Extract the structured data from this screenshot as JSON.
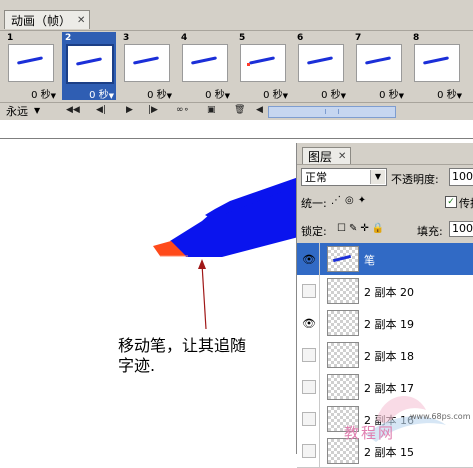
{
  "animation": {
    "tab_title": "动画（帧）",
    "frames": [
      {
        "num": "1",
        "delay": "0 秒"
      },
      {
        "num": "2",
        "delay": "0 秒"
      },
      {
        "num": "3",
        "delay": "0 秒"
      },
      {
        "num": "4",
        "delay": "0 秒"
      },
      {
        "num": "5",
        "delay": "0 秒"
      },
      {
        "num": "6",
        "delay": "0 秒"
      },
      {
        "num": "7",
        "delay": "0 秒"
      },
      {
        "num": "8",
        "delay": "0 秒"
      }
    ],
    "selected_frame_index": 1,
    "loop_option": "永远"
  },
  "canvas": {
    "caption_line1": "移动笔，让其追随",
    "caption_line2": "字迹.",
    "pen_color": "#0a14ee",
    "tip_color": "#ff4a1a",
    "arrow_color": "#a01818"
  },
  "layers": {
    "tab_title": "图层",
    "blend_mode": "正常",
    "opacity_label": "不透明度:",
    "opacity_value": "100",
    "unify_label": "统一:",
    "propagate_label": "传播",
    "lock_label": "锁定:",
    "fill_label": "填充:",
    "fill_value": "100",
    "items": [
      {
        "name": "笔",
        "visible": true,
        "selected": true
      },
      {
        "name": "2 副本 20",
        "visible": false,
        "selected": false
      },
      {
        "name": "2 副本 19",
        "visible": true,
        "selected": false
      },
      {
        "name": "2 副本 18",
        "visible": false,
        "selected": false
      },
      {
        "name": "2 副本 17",
        "visible": false,
        "selected": false
      },
      {
        "name": "2 副本 16",
        "visible": false,
        "selected": false
      },
      {
        "name": "2 副本 15",
        "visible": false,
        "selected": false
      }
    ]
  },
  "watermark": {
    "text": "教程网",
    "url": "www.68ps.com"
  }
}
